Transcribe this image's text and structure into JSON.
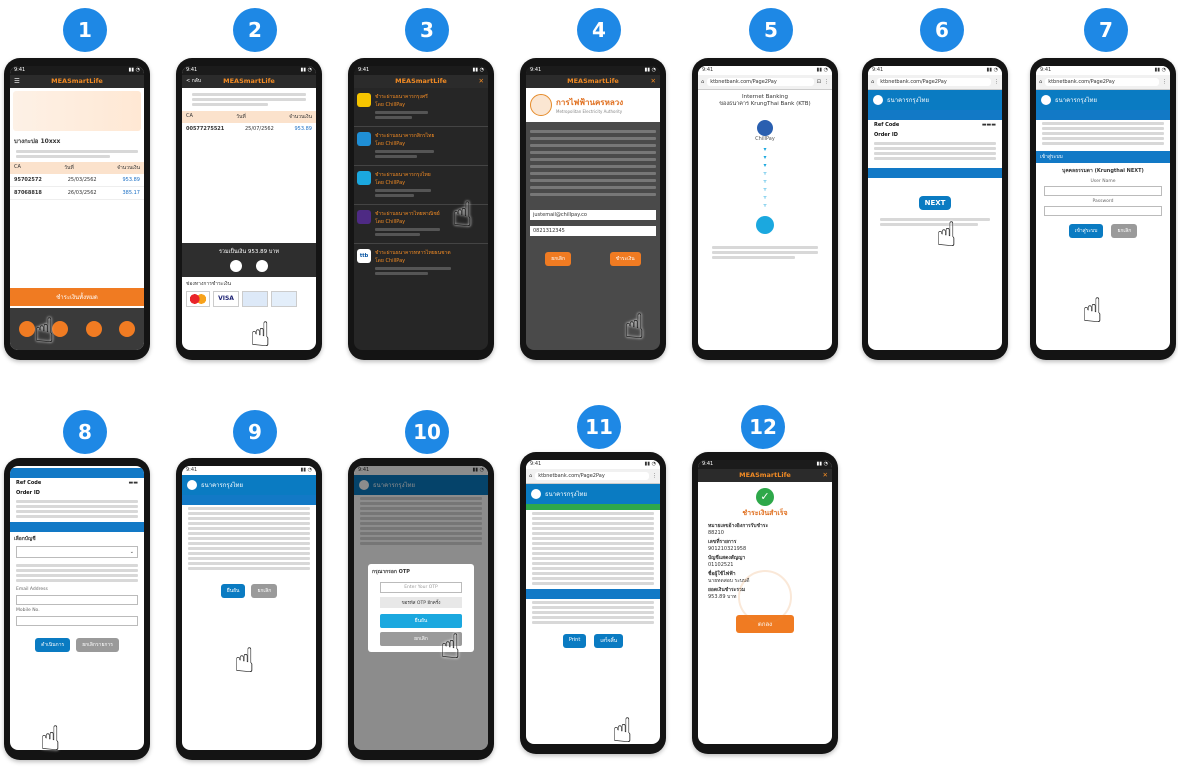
{
  "steps": [
    {
      "number": "1",
      "app": "MEASmartLife",
      "label_address": "บางกะปอ 10xxx",
      "account_rows": [
        {
          "ca": "95702572",
          "date": "25/03/2562",
          "amount": "953.89"
        },
        {
          "ca": "87068818",
          "date": "26/03/2562",
          "amount": "385.17"
        }
      ],
      "pay_button": "ชำระเงินทั้งหมด"
    },
    {
      "number": "2",
      "app": "MEASmartLife",
      "back": "< กลับ",
      "bill_ca": "00577275521",
      "bill_date": "25/07/2562",
      "bill_amount": "953.89",
      "total": "รวมเป็นเงิน 953.89 บาท",
      "pay_methods_label": "ช่องทางการชำระเงิน",
      "card_visa": "VISA"
    },
    {
      "number": "3",
      "app": "MEASmartLife",
      "channels": [
        {
          "name": "ชำระผ่านธนาคารกรุงศรี",
          "via": "โดย ChillPay"
        },
        {
          "name": "ชำระผ่านธนาคารกสิกรไทย",
          "via": "โดย ChillPay"
        },
        {
          "name": "ชำระผ่านธนาคารกรุงไทย",
          "via": "โดย ChillPay"
        },
        {
          "name": "ชำระผ่านธนาคารไทยพาณิชย์",
          "via": "โดย ChillPay"
        },
        {
          "name": "ชำระผ่านธนาคารทหารไทยธนชาต",
          "via": "โดย ChillPay"
        }
      ],
      "ttb": "ttb"
    },
    {
      "number": "4",
      "app": "MEASmartLife",
      "brand_th": "การไฟฟ้านครหลวง",
      "brand_en": "Metropolitan Electricity Authority",
      "email": "justemail@chillpay.co",
      "phone": "0821312345",
      "cancel": "ยกเลิก",
      "confirm": "ชำระเงิน"
    },
    {
      "number": "5",
      "url": "ktbnetbank.com/Page2Pay",
      "title_line1": "Internet Banking",
      "title_line2": "ของธนาคาร KrungThai Bank (KTB)",
      "gateway": "ChillPay"
    },
    {
      "number": "6",
      "url": "ktbnetbank.com/Page2Pay",
      "bank": "ธนาคารกรุงไทย",
      "ref_code": "Ref Code",
      "order_id": "Order ID",
      "next_logo": "NEXT"
    },
    {
      "number": "7",
      "url": "ktbnetbank.com/Page2Pay",
      "bank": "ธนาคารกรุงไทย",
      "login_title": "เข้าสู่ระบบ",
      "login_note": "บุคคลธรรมดา (Krungthai NEXT)",
      "user": "User Name",
      "pass": "Password",
      "ok": "เข้าสู่ระบบ",
      "cancel": "ยกเลิก"
    },
    {
      "number": "8",
      "ref_code": "Ref Code",
      "order_id": "Order ID",
      "account_select": "เลือกบัญชี",
      "email_label": "Email Address",
      "mobile_label": "Mobile No.",
      "ok": "ดำเนินการ",
      "cancel": "ยกเลิกรายการ"
    },
    {
      "number": "9",
      "bank": "ธนาคารกรุงไทย",
      "ok": "ยืนยัน",
      "cancel": "ยกเลิก"
    },
    {
      "number": "10",
      "bank": "ธนาคารกรุงไทย",
      "otp_title": "กรุณากรอก OTP",
      "otp_placeholder": "Enter Your OTP",
      "otp_resend": "ขอรหัส OTP อีกครั้ง",
      "ok": "ยืนยัน",
      "cancel": "ยกเลิก"
    },
    {
      "number": "11",
      "url": "ktbnetbank.com/Page2Pay",
      "bank": "ธนาคารกรุงไทย",
      "print": "Print",
      "done": "เสร็จสิ้น"
    },
    {
      "number": "12",
      "app": "MEASmartLife",
      "success": "ชำระเงินสำเร็จ",
      "ref_label": "หมายเลขอ้างอิงการรับชำระ",
      "ref_value": "88210",
      "tx_label": "เลขที่รายการ",
      "tx_value": "901210321958",
      "ca_label": "บัญชีแสดงสัญญา",
      "ca_value": "01102521",
      "name_label": "ชื่อผู้ใช้ไฟฟ้า",
      "name_value": "นายทดสอบ ระบบดี",
      "total_label": "ยอดเงินชำระรวม",
      "total_value": "953.89 บาท",
      "ok": "ตกลง"
    }
  ],
  "colors": {
    "badge": "#1e88e5",
    "mea_orange": "#f07b22",
    "ktb_blue": "#0a7bc2"
  }
}
